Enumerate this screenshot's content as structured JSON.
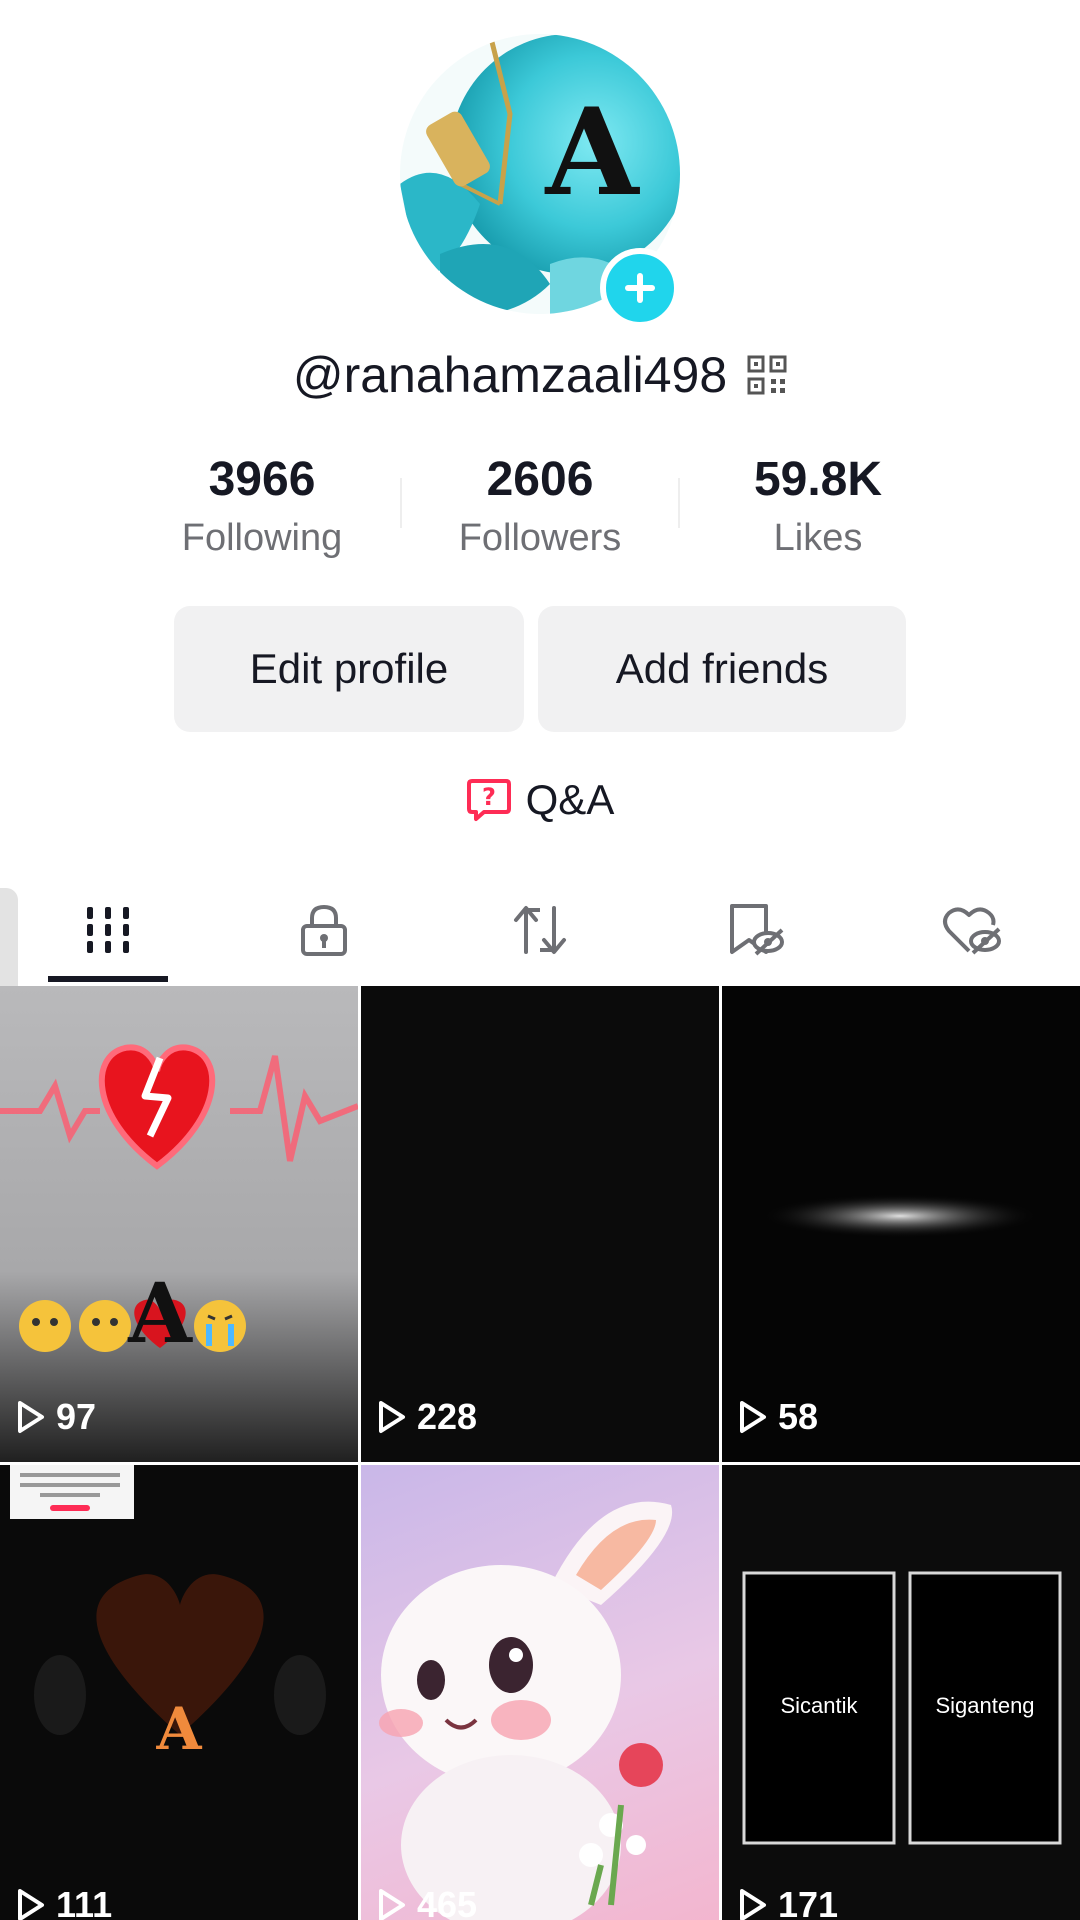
{
  "profile": {
    "username": "@ranahamzaali498",
    "avatar_letter": "A"
  },
  "stats": [
    {
      "value": "3966",
      "label": "Following"
    },
    {
      "value": "2606",
      "label": "Followers"
    },
    {
      "value": "59.8K",
      "label": "Likes"
    }
  ],
  "actions": {
    "edit_profile": "Edit profile",
    "add_friends": "Add friends"
  },
  "qa": {
    "label": "Q&A"
  },
  "tabs": [
    {
      "icon": "grid-icon",
      "active": true
    },
    {
      "icon": "lock-icon",
      "active": false
    },
    {
      "icon": "repost-icon",
      "active": false
    },
    {
      "icon": "bookmark-hidden-icon",
      "active": false
    },
    {
      "icon": "liked-hidden-icon",
      "active": false
    }
  ],
  "videos": [
    {
      "views": "97",
      "overlay": "A"
    },
    {
      "views": "228"
    },
    {
      "views": "58"
    },
    {
      "views": "111",
      "overlay": "A"
    },
    {
      "views": "465"
    },
    {
      "views": "171",
      "labels": [
        "Sicantik",
        "Siganteng"
      ]
    }
  ],
  "colors": {
    "accent_plus": "#20d5ec",
    "qa_icon": "#fe2c55",
    "text_primary": "#161823",
    "text_secondary": "#6e6f74",
    "button_bg": "#f1f1f2"
  }
}
